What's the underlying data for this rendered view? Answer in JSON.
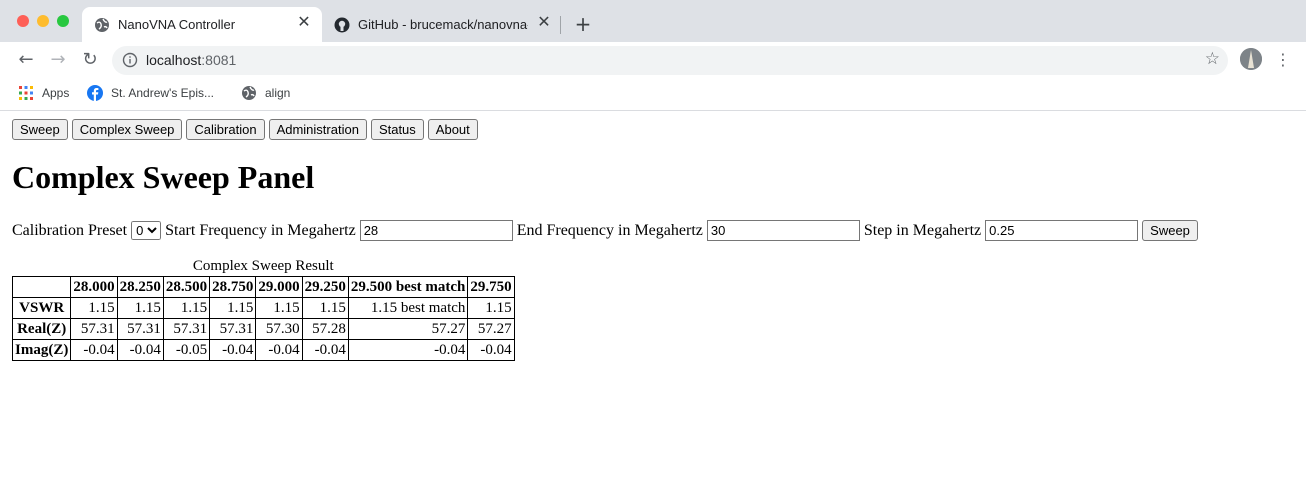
{
  "browser": {
    "tabs": [
      {
        "title": "NanoVNA Controller",
        "icon": "globe-icon",
        "active": true
      },
      {
        "title": "GitHub - brucemack/nanovna-",
        "icon": "github-icon",
        "active": false
      }
    ],
    "new_tab": "+",
    "address": {
      "host": "localhost",
      "port": ":8081"
    },
    "bookmarks": [
      {
        "label": "Apps",
        "icon": "apps-grid-icon"
      },
      {
        "label": "St. Andrew's Epis...",
        "icon": "facebook-icon"
      },
      {
        "label": "align",
        "icon": "globe-icon"
      }
    ]
  },
  "page": {
    "menu": [
      "Sweep",
      "Complex Sweep",
      "Calibration",
      "Administration",
      "Status",
      "About"
    ],
    "heading": "Complex Sweep Panel",
    "form": {
      "preset_label": "Calibration Preset",
      "preset_value": "0",
      "start_label": "Start Frequency in Megahertz",
      "start_value": "28",
      "end_label": "End Frequency in Megahertz",
      "end_value": "30",
      "step_label": "Step in Megahertz",
      "step_value": "0.25",
      "sweep_button": "Sweep"
    },
    "result": {
      "caption": "Complex Sweep Result",
      "columns": [
        "28.000",
        "28.250",
        "28.500",
        "28.750",
        "29.000",
        "29.250",
        "29.500 best match",
        "29.750"
      ],
      "rows": [
        {
          "label": "VSWR",
          "values": [
            "1.15",
            "1.15",
            "1.15",
            "1.15",
            "1.15",
            "1.15",
            "1.15 best match",
            "1.15"
          ]
        },
        {
          "label": "Real(Z)",
          "values": [
            "57.31",
            "57.31",
            "57.31",
            "57.31",
            "57.30",
            "57.28",
            "57.27",
            "57.27"
          ]
        },
        {
          "label": "Imag(Z)",
          "values": [
            "-0.04",
            "-0.04",
            "-0.05",
            "-0.04",
            "-0.04",
            "-0.04",
            "-0.04",
            "-0.04"
          ]
        }
      ]
    }
  }
}
